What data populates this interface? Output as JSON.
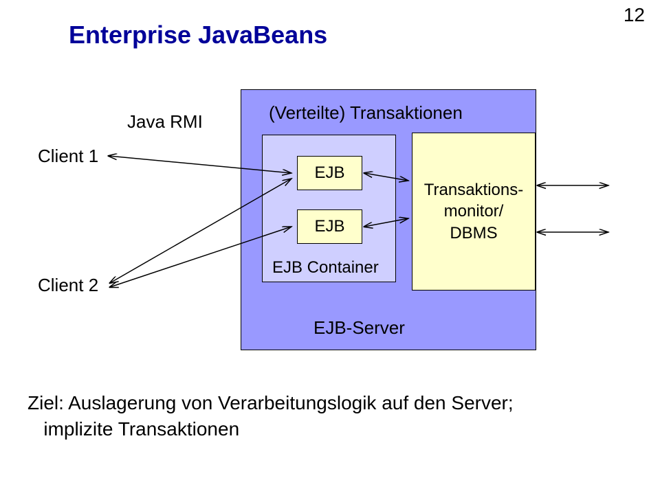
{
  "page_number": "12",
  "title": "Enterprise JavaBeans",
  "rmi_label": "Java RMI",
  "client1": "Client 1",
  "client2": "Client 2",
  "server": {
    "label": "EJB-Server",
    "distributed_tx": "(Verteilte) Transaktionen",
    "container_label": "EJB Container",
    "ejb1": "EJB",
    "ejb2": "EJB",
    "monitor_line1": "Transaktions-",
    "monitor_line2": "monitor/",
    "monitor_line3": "DBMS"
  },
  "goal": "Ziel: Auslagerung von Verarbeitungslogik auf den Server;",
  "goal_sub": "implizite Transaktionen",
  "colors": {
    "title": "#000099",
    "server_fill": "#9999ff",
    "container_fill": "#cfcfff",
    "accent_fill": "#ffffcc"
  },
  "chart_data": {
    "type": "diagram",
    "title": "Enterprise JavaBeans Architecture",
    "nodes": [
      {
        "id": "client1",
        "label": "Client 1"
      },
      {
        "id": "client2",
        "label": "Client 2"
      },
      {
        "id": "ejb-server",
        "label": "EJB-Server",
        "children": [
          {
            "id": "distributed-tx",
            "label": "(Verteilte) Transaktionen"
          },
          {
            "id": "ejb-container",
            "label": "EJB Container",
            "children": [
              {
                "id": "ejb1",
                "label": "EJB"
              },
              {
                "id": "ejb2",
                "label": "EJB"
              }
            ]
          },
          {
            "id": "monitor",
            "label": "Transaktionsmonitor/ DBMS"
          }
        ]
      }
    ],
    "edges": [
      {
        "from": "client1",
        "to": "ejb1",
        "label": "Java RMI",
        "bidirectional": true
      },
      {
        "from": "client2",
        "to": "ejb1",
        "bidirectional": true
      },
      {
        "from": "client2",
        "to": "ejb2",
        "bidirectional": true
      },
      {
        "from": "ejb1",
        "to": "monitor",
        "bidirectional": true
      },
      {
        "from": "ejb2",
        "to": "monitor",
        "bidirectional": true
      },
      {
        "from": "monitor",
        "to": "external-right",
        "bidirectional": true
      }
    ]
  }
}
